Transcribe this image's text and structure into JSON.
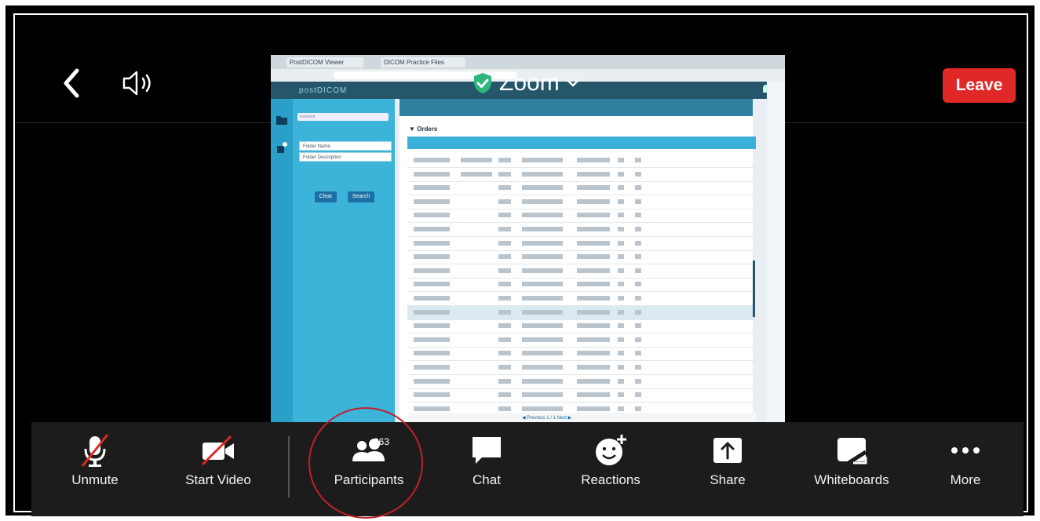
{
  "header": {
    "meeting_title": "Zoom",
    "leave_label": "Leave"
  },
  "shared_screen": {
    "browser_tab_1": "PostDICOM Viewer",
    "browser_tab_2": "DICOM Practice Files",
    "logo_text": "postDICOM",
    "search_placeholder": "Keyword",
    "folder_name_label": "Folder Name",
    "folder_description_label": "Folder Description",
    "clear_label": "Clear",
    "search_label": "Search",
    "orders_label": "▼ Orders",
    "pager_text": "◀ Previous  1 / 1  Next ▶"
  },
  "toolbar": {
    "items": [
      {
        "label": "Unmute"
      },
      {
        "label": "Start Video"
      },
      {
        "label": "Participants",
        "count": "263"
      },
      {
        "label": "Chat"
      },
      {
        "label": "Reactions"
      },
      {
        "label": "Share"
      },
      {
        "label": "Whiteboards"
      },
      {
        "label": "More"
      }
    ]
  },
  "colors": {
    "leave": "#e02828",
    "toolbar_bg": "#1c1c1c",
    "highlight_circle": "#c0212a",
    "shield": "#2fb67a"
  }
}
